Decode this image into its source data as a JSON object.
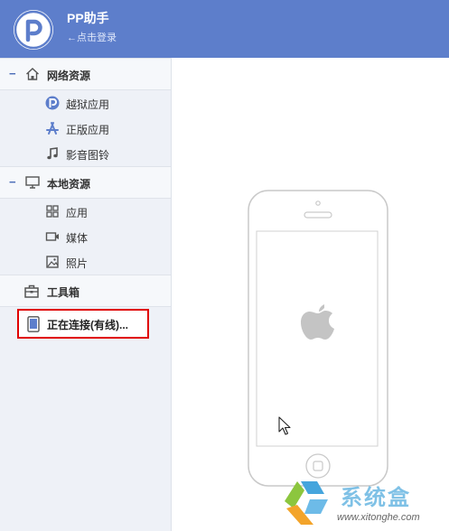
{
  "app": {
    "title": "PP助手",
    "login_text": "←点击登录",
    "logo_letter": "P",
    "accent_color": "#5d7ecb"
  },
  "sidebar": {
    "sections": [
      {
        "label": "网络资源",
        "icon": "home-icon",
        "collapse_symbol": "−",
        "items": [
          {
            "label": "越狱应用",
            "icon": "pp-logo-icon"
          },
          {
            "label": "正版应用",
            "icon": "app-store-icon"
          },
          {
            "label": "影音图铃",
            "icon": "music-note-icon"
          }
        ]
      },
      {
        "label": "本地资源",
        "icon": "monitor-icon",
        "collapse_symbol": "−",
        "items": [
          {
            "label": "应用",
            "icon": "grid-icon"
          },
          {
            "label": "媒体",
            "icon": "video-icon"
          },
          {
            "label": "照片",
            "icon": "photo-icon"
          }
        ]
      }
    ],
    "toolbox": {
      "label": "工具箱",
      "icon": "toolbox-icon"
    },
    "device": {
      "label": "正在连接(有线)...",
      "icon": "phone-icon",
      "highlight_color": "#e00000"
    }
  },
  "main": {
    "device_graphic": "iphone-outline",
    "logo": "apple-icon"
  },
  "watermark": {
    "title": "系统盒",
    "url": "www.xitonghe.com"
  }
}
